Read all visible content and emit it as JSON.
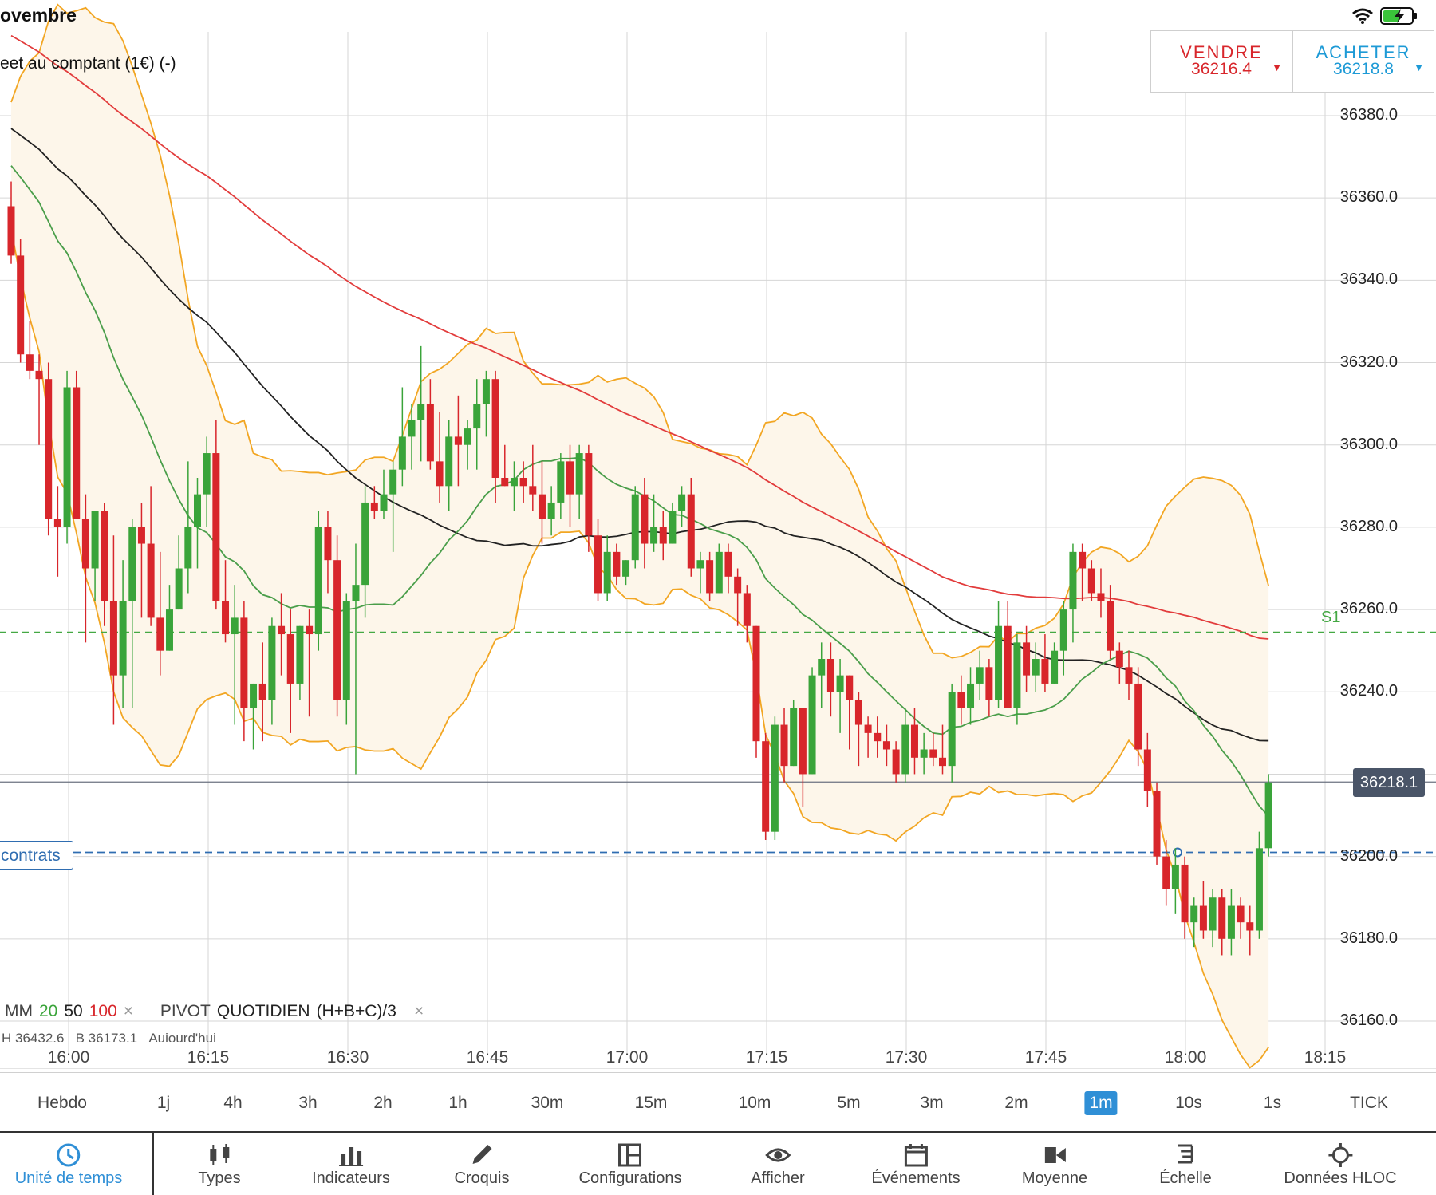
{
  "status": {
    "time": "ovembre"
  },
  "instrument": {
    "title": "eet au comptant (1€) (-)"
  },
  "trade": {
    "sell": {
      "label": "VENDRE",
      "price": "36216.4"
    },
    "buy": {
      "label": "ACHETER",
      "price": "36218.8"
    }
  },
  "price_axis": [
    "36380.0",
    "36360.0",
    "36340.0",
    "36320.0",
    "36300.0",
    "36280.0",
    "36260.0",
    "36240.0",
    "36200.0",
    "36180.0",
    "36160.0"
  ],
  "current_price": "36218.1",
  "pivot_label": "S1",
  "position_label": "contrats",
  "legend": {
    "mm": "MM",
    "mm20": "20",
    "mm50": "50",
    "mm100": "100",
    "close": "×",
    "pivot": "PIVOT",
    "pivot_mode": "QUOTIDIEN",
    "pivot_formula": "(H+B+C)/3",
    "close2": "×",
    "hl_high": "H 36432.6",
    "hl_low": "B 36173.1",
    "hl_day": "Aujourd'hui"
  },
  "time_axis": [
    "16:00",
    "16:15",
    "16:30",
    "16:45",
    "17:00",
    "17:15",
    "17:30",
    "17:45",
    "18:00",
    "18:15"
  ],
  "timeframes": [
    "Hebdo",
    "1j",
    "4h",
    "3h",
    "2h",
    "1h",
    "30m",
    "15m",
    "10m",
    "5m",
    "3m",
    "2m",
    "1m",
    "10s",
    "1s",
    "TICK"
  ],
  "active_timeframe": "1m",
  "tools": [
    {
      "label": "Unité de temps",
      "icon": "clock-icon"
    },
    {
      "label": "Types",
      "icon": "candlestick-icon"
    },
    {
      "label": "Indicateurs",
      "icon": "bar-chart-icon"
    },
    {
      "label": "Croquis",
      "icon": "pencil-icon"
    },
    {
      "label": "Configurations",
      "icon": "layout-icon"
    },
    {
      "label": "Afficher",
      "icon": "eye-icon"
    },
    {
      "label": "Événements",
      "icon": "calendar-icon"
    },
    {
      "label": "Moyenne",
      "icon": "video-icon"
    },
    {
      "label": "Échelle",
      "icon": "scale-icon"
    },
    {
      "label": "Données HLOC",
      "icon": "crosshair-icon"
    }
  ],
  "colors": {
    "bull": "#3aa43a",
    "bear": "#d8262b",
    "ma20": "#4a9e4a",
    "ma50": "#222222",
    "ma100": "#e23c3c",
    "bollinger": "#f2a623",
    "band_fill": "#fdf6ea",
    "pivot": "#44a843",
    "position": "#2f6db1",
    "accent": "#2f8fd6"
  },
  "chart_data": {
    "type": "candlestick",
    "interval": "1m",
    "x": [
      "15:58",
      "15:59",
      "16:00",
      "16:01",
      "16:02",
      "16:03",
      "16:04",
      "16:05",
      "16:06",
      "16:07",
      "16:08",
      "16:09",
      "16:10",
      "16:11",
      "16:12",
      "16:13",
      "16:14",
      "16:15",
      "16:16",
      "16:17",
      "16:18",
      "16:19",
      "16:20",
      "16:21",
      "16:22",
      "16:23",
      "16:24",
      "16:25",
      "16:26",
      "16:27",
      "16:28",
      "16:29",
      "16:30",
      "16:31",
      "16:32",
      "16:33",
      "16:34",
      "16:35",
      "16:36",
      "16:37",
      "16:38",
      "16:39",
      "16:40",
      "16:41",
      "16:42",
      "16:43",
      "16:44",
      "16:45",
      "16:46",
      "16:47",
      "16:48",
      "16:49",
      "16:50",
      "16:51",
      "16:52",
      "16:53",
      "16:54",
      "16:55",
      "16:56",
      "16:57",
      "16:58",
      "16:59",
      "17:00",
      "17:01",
      "17:02",
      "17:03",
      "17:04",
      "17:05",
      "17:06",
      "17:07",
      "17:08",
      "17:09",
      "17:10",
      "17:11",
      "17:12",
      "17:13",
      "17:14",
      "17:15",
      "17:16",
      "17:17",
      "17:18",
      "17:19",
      "17:20",
      "17:21",
      "17:22",
      "17:23",
      "17:24",
      "17:25",
      "17:26",
      "17:27",
      "17:28",
      "17:29",
      "17:30",
      "17:31",
      "17:32",
      "17:33",
      "17:34",
      "17:35",
      "17:36",
      "17:37",
      "17:38",
      "17:39",
      "17:40",
      "17:41",
      "17:42",
      "17:43",
      "17:44",
      "17:45",
      "17:46",
      "17:47",
      "17:48",
      "17:49",
      "17:50",
      "17:51",
      "17:52",
      "17:53",
      "17:54",
      "17:55",
      "17:56",
      "17:57",
      "17:58",
      "17:59",
      "18:00",
      "18:01",
      "18:02",
      "18:03",
      "18:04",
      "18:05",
      "18:06",
      "18:07",
      "18:08",
      "18:09",
      "18:10",
      "18:11"
    ],
    "ohlc": [
      [
        36358,
        36364,
        36344,
        36346
      ],
      [
        36346,
        36350,
        36320,
        36322
      ],
      [
        36322,
        36330,
        36316,
        36318
      ],
      [
        36318,
        36322,
        36300,
        36316
      ],
      [
        36316,
        36320,
        36278,
        36282
      ],
      [
        36282,
        36290,
        36268,
        36280
      ],
      [
        36280,
        36318,
        36276,
        36314
      ],
      [
        36314,
        36318,
        36282,
        36282
      ],
      [
        36282,
        36288,
        36252,
        36270
      ],
      [
        36270,
        36284,
        36262,
        36284
      ],
      [
        36284,
        36286,
        36256,
        36262
      ],
      [
        36262,
        36278,
        36232,
        36244
      ],
      [
        36244,
        36272,
        36236,
        36262
      ],
      [
        36262,
        36282,
        36236,
        36280
      ],
      [
        36280,
        36286,
        36258,
        36276
      ],
      [
        36276,
        36290,
        36256,
        36258
      ],
      [
        36258,
        36274,
        36244,
        36250
      ],
      [
        36250,
        36266,
        36250,
        36260
      ],
      [
        36260,
        36278,
        36260,
        36270
      ],
      [
        36270,
        36296,
        36264,
        36280
      ],
      [
        36280,
        36292,
        36270,
        36288
      ],
      [
        36288,
        36302,
        36280,
        36298
      ],
      [
        36298,
        36306,
        36260,
        36262
      ],
      [
        36262,
        36272,
        36252,
        36254
      ],
      [
        36254,
        36266,
        36232,
        36258
      ],
      [
        36258,
        36262,
        36228,
        36236
      ],
      [
        36236,
        36242,
        36226,
        36242
      ],
      [
        36242,
        36252,
        36228,
        36238
      ],
      [
        36238,
        36258,
        36232,
        36256
      ],
      [
        36256,
        36264,
        36244,
        36254
      ],
      [
        36254,
        36260,
        36230,
        36242
      ],
      [
        36242,
        36256,
        36238,
        36256
      ],
      [
        36256,
        36260,
        36234,
        36254
      ],
      [
        36254,
        36284,
        36250,
        36280
      ],
      [
        36280,
        36284,
        36264,
        36272
      ],
      [
        36272,
        36278,
        36234,
        36238
      ],
      [
        36238,
        36264,
        36232,
        36262
      ],
      [
        36262,
        36276,
        36220,
        36266
      ],
      [
        36266,
        36290,
        36258,
        36286
      ],
      [
        36286,
        36290,
        36282,
        36284
      ],
      [
        36284,
        36294,
        36282,
        36288
      ],
      [
        36288,
        36296,
        36274,
        36294
      ],
      [
        36294,
        36314,
        36290,
        36302
      ],
      [
        36302,
        36310,
        36294,
        36306
      ],
      [
        36306,
        36324,
        36296,
        36310
      ],
      [
        36310,
        36316,
        36294,
        36296
      ],
      [
        36296,
        36308,
        36286,
        36290
      ],
      [
        36290,
        36306,
        36284,
        36302
      ],
      [
        36302,
        36312,
        36290,
        36300
      ],
      [
        36300,
        36306,
        36294,
        36304
      ],
      [
        36304,
        36316,
        36294,
        36310
      ],
      [
        36310,
        36318,
        36302,
        36316
      ],
      [
        36316,
        36318,
        36286,
        36292
      ],
      [
        36292,
        36300,
        36290,
        36290
      ],
      [
        36290,
        36296,
        36284,
        36292
      ],
      [
        36292,
        36296,
        36286,
        36290
      ],
      [
        36290,
        36300,
        36284,
        36288
      ],
      [
        36288,
        36296,
        36276,
        36282
      ],
      [
        36282,
        36290,
        36278,
        36286
      ],
      [
        36286,
        36298,
        36282,
        36296
      ],
      [
        36296,
        36300,
        36280,
        36288
      ],
      [
        36288,
        36300,
        36282,
        36298
      ],
      [
        36298,
        36300,
        36274,
        36278
      ],
      [
        36278,
        36282,
        36262,
        36264
      ],
      [
        36264,
        36278,
        36262,
        36274
      ],
      [
        36274,
        36276,
        36266,
        36268
      ],
      [
        36268,
        36272,
        36266,
        36272
      ],
      [
        36272,
        36290,
        36270,
        36288
      ],
      [
        36288,
        36292,
        36270,
        36276
      ],
      [
        36276,
        36288,
        36274,
        36280
      ],
      [
        36280,
        36284,
        36272,
        36276
      ],
      [
        36276,
        36286,
        36276,
        36284
      ],
      [
        36284,
        36290,
        36280,
        36288
      ],
      [
        36288,
        36292,
        36268,
        36270
      ],
      [
        36270,
        36274,
        36264,
        36272
      ],
      [
        36272,
        36274,
        36262,
        36264
      ],
      [
        36264,
        36276,
        36264,
        36274
      ],
      [
        36274,
        36276,
        36264,
        36268
      ],
      [
        36268,
        36270,
        36256,
        36264
      ],
      [
        36264,
        36266,
        36252,
        36256
      ],
      [
        36256,
        36256,
        36224,
        36228
      ],
      [
        36228,
        36230,
        36204,
        36206
      ],
      [
        36206,
        36234,
        36204,
        36232
      ],
      [
        36232,
        36236,
        36218,
        36222
      ],
      [
        36222,
        36238,
        36222,
        36236
      ],
      [
        36236,
        36236,
        36212,
        36220
      ],
      [
        36220,
        36246,
        36220,
        36244
      ],
      [
        36244,
        36252,
        36236,
        36248
      ],
      [
        36248,
        36252,
        36234,
        36240
      ],
      [
        36240,
        36248,
        36230,
        36244
      ],
      [
        36244,
        36244,
        36226,
        36238
      ],
      [
        36238,
        36240,
        36222,
        36232
      ],
      [
        36232,
        36234,
        36224,
        36230
      ],
      [
        36230,
        36234,
        36224,
        36228
      ],
      [
        36228,
        36232,
        36222,
        36226
      ],
      [
        36226,
        36228,
        36218,
        36220
      ],
      [
        36220,
        36236,
        36218,
        36232
      ],
      [
        36232,
        36236,
        36220,
        36224
      ],
      [
        36224,
        36230,
        36220,
        36226
      ],
      [
        36226,
        36230,
        36222,
        36224
      ],
      [
        36224,
        36232,
        36220,
        36222
      ],
      [
        36222,
        36242,
        36218,
        36240
      ],
      [
        36240,
        36244,
        36232,
        36236
      ],
      [
        36236,
        36246,
        36232,
        36242
      ],
      [
        36242,
        36250,
        36238,
        36246
      ],
      [
        36246,
        36248,
        36234,
        36238
      ],
      [
        36238,
        36262,
        36236,
        36256
      ],
      [
        36256,
        36262,
        36236,
        36236
      ],
      [
        36236,
        36254,
        36232,
        36252
      ],
      [
        36252,
        36256,
        36240,
        36244
      ],
      [
        36244,
        36252,
        36240,
        36248
      ],
      [
        36248,
        36254,
        36240,
        36242
      ],
      [
        36242,
        36252,
        36242,
        36250
      ],
      [
        36250,
        36262,
        36244,
        36260
      ],
      [
        36260,
        36276,
        36252,
        36274
      ],
      [
        36274,
        36276,
        36262,
        36270
      ],
      [
        36270,
        36272,
        36262,
        36264
      ],
      [
        36264,
        36270,
        36258,
        36262
      ],
      [
        36262,
        36266,
        36248,
        36250
      ],
      [
        36250,
        36252,
        36242,
        36246
      ],
      [
        36246,
        36250,
        36238,
        36242
      ],
      [
        36242,
        36246,
        36222,
        36226
      ],
      [
        36226,
        36230,
        36212,
        36216
      ],
      [
        36216,
        36218,
        36198,
        36200
      ],
      [
        36200,
        36204,
        36188,
        36192
      ],
      [
        36192,
        36202,
        36186,
        36198
      ],
      [
        36198,
        36200,
        36180,
        36184
      ],
      [
        36184,
        36190,
        36178,
        36188
      ],
      [
        36188,
        36194,
        36180,
        36182
      ],
      [
        36182,
        36192,
        36178,
        36190
      ],
      [
        36190,
        36192,
        36176,
        36180
      ],
      [
        36180,
        36192,
        36176,
        36188
      ],
      [
        36188,
        36190,
        36180,
        36184
      ],
      [
        36184,
        36188,
        36176,
        36182
      ],
      [
        36182,
        36206,
        36180,
        36202
      ],
      [
        36202,
        36220,
        36200,
        36218
      ]
    ],
    "price_range": [
      36155,
      36398
    ],
    "pivot_s1": 36254.5,
    "position_price": 36201.0
  }
}
